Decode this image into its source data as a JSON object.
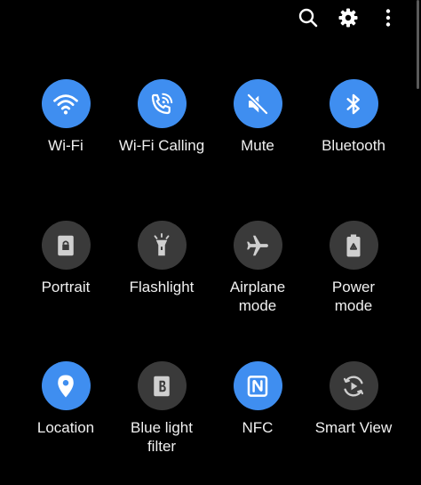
{
  "colors": {
    "active": "#3f8ef0",
    "inactive": "#3a3a3a",
    "active_icon": "#ffffff",
    "inactive_icon": "#cfcfcf"
  },
  "top_bar": {
    "icons": [
      "search-icon",
      "gear-icon",
      "more-vertical-icon"
    ]
  },
  "tiles": [
    {
      "label": "Wi-Fi",
      "icon": "wifi-icon",
      "state": "active"
    },
    {
      "label": "Wi-Fi Calling",
      "icon": "wifi-calling-icon",
      "state": "active"
    },
    {
      "label": "Mute",
      "icon": "mute-icon",
      "state": "active"
    },
    {
      "label": "Bluetooth",
      "icon": "bluetooth-icon",
      "state": "active"
    },
    {
      "label": "Portrait",
      "icon": "portrait-lock-icon",
      "state": "inactive"
    },
    {
      "label": "Flashlight",
      "icon": "flashlight-icon",
      "state": "inactive"
    },
    {
      "label": "Airplane\nmode",
      "icon": "airplane-icon",
      "state": "inactive"
    },
    {
      "label": "Power\nmode",
      "icon": "battery-recycle-icon",
      "state": "inactive"
    },
    {
      "label": "Location",
      "icon": "location-pin-icon",
      "state": "active"
    },
    {
      "label": "Blue light\nfilter",
      "icon": "blue-light-icon",
      "state": "inactive"
    },
    {
      "label": "NFC",
      "icon": "nfc-icon",
      "state": "active"
    },
    {
      "label": "Smart View",
      "icon": "smart-view-icon",
      "state": "inactive"
    }
  ]
}
